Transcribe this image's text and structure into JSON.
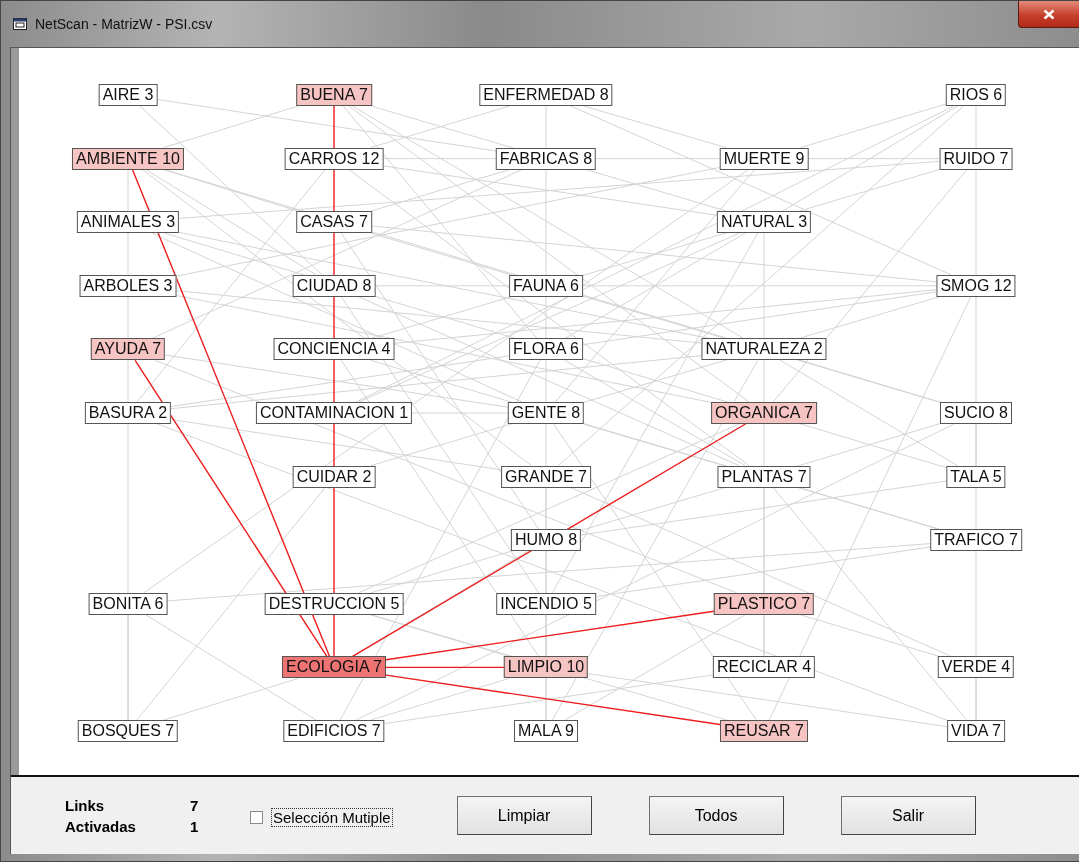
{
  "window": {
    "title": "NetScan - MatrizW - PSI.csv"
  },
  "graph": {
    "rows": [
      {
        "cells": [
          {
            "kind": "node",
            "label": "AIRE 3",
            "linked": false,
            "selected": false
          },
          {
            "kind": "node",
            "label": "BUENA 7",
            "linked": true,
            "selected": false
          },
          {
            "kind": "node",
            "label": "ENFERMEDAD 8",
            "linked": false,
            "selected": false
          },
          {
            "kind": "gap"
          },
          {
            "kind": "node",
            "label": "RIOS 6",
            "linked": false,
            "selected": false
          }
        ]
      },
      {
        "cells": [
          {
            "kind": "node",
            "label": "AMBIENTE 10",
            "linked": true,
            "selected": false
          },
          {
            "kind": "node",
            "label": "CARROS 12",
            "linked": false,
            "selected": false
          },
          {
            "kind": "node",
            "label": "FABRICAS 8",
            "linked": false,
            "selected": false
          },
          {
            "kind": "node",
            "label": "MUERTE 9",
            "linked": false,
            "selected": false
          },
          {
            "kind": "node",
            "label": "RUIDO 7",
            "linked": false,
            "selected": false
          }
        ]
      },
      {
        "cells": [
          {
            "kind": "node",
            "label": "ANIMALES 3",
            "linked": false,
            "selected": false
          },
          {
            "kind": "node",
            "label": "CASAS 7",
            "linked": false,
            "selected": false
          },
          {
            "kind": "gap"
          },
          {
            "kind": "node",
            "label": "NATURAL 3",
            "linked": false,
            "selected": false
          },
          {
            "kind": "gap"
          }
        ]
      },
      {
        "cells": [
          {
            "kind": "node",
            "label": "ARBOLES 3",
            "linked": false,
            "selected": false
          },
          {
            "kind": "node",
            "label": "CIUDAD 8",
            "linked": false,
            "selected": false
          },
          {
            "kind": "node",
            "label": "FAUNA 6",
            "linked": false,
            "selected": false
          },
          {
            "kind": "gap"
          },
          {
            "kind": "node",
            "label": "SMOG 12",
            "linked": false,
            "selected": false
          }
        ]
      },
      {
        "cells": [
          {
            "kind": "node",
            "label": "AYUDA 7",
            "linked": true,
            "selected": false
          },
          {
            "kind": "node",
            "label": "CONCIENCIA 4",
            "linked": false,
            "selected": false
          },
          {
            "kind": "node",
            "label": "FLORA 6",
            "linked": false,
            "selected": false
          },
          {
            "kind": "node",
            "label": "NATURALEZA 2",
            "linked": false,
            "selected": false
          },
          {
            "kind": "gap"
          }
        ]
      },
      {
        "cells": [
          {
            "kind": "node",
            "label": "BASURA 2",
            "linked": false,
            "selected": false
          },
          {
            "kind": "node",
            "label": "CONTAMINACION 1",
            "linked": false,
            "selected": false
          },
          {
            "kind": "node",
            "label": "GENTE 8",
            "linked": false,
            "selected": false
          },
          {
            "kind": "node",
            "label": "ORGANICA 7",
            "linked": true,
            "selected": false
          },
          {
            "kind": "node",
            "label": "SUCIO 8",
            "linked": false,
            "selected": false
          }
        ]
      },
      {
        "cells": [
          {
            "kind": "gap"
          },
          {
            "kind": "node",
            "label": "CUIDAR 2",
            "linked": false,
            "selected": false
          },
          {
            "kind": "node",
            "label": "GRANDE 7",
            "linked": false,
            "selected": false
          },
          {
            "kind": "node",
            "label": "PLANTAS 7",
            "linked": false,
            "selected": false
          },
          {
            "kind": "node",
            "label": "TALA 5",
            "linked": false,
            "selected": false
          }
        ]
      },
      {
        "cells": [
          {
            "kind": "gap"
          },
          {
            "kind": "gap"
          },
          {
            "kind": "node",
            "label": "HUMO 8",
            "linked": false,
            "selected": false
          },
          {
            "kind": "gap"
          },
          {
            "kind": "node",
            "label": "TRAFICO 7",
            "linked": false,
            "selected": false
          }
        ]
      },
      {
        "cells": [
          {
            "kind": "node",
            "label": "BONITA 6",
            "linked": false,
            "selected": false
          },
          {
            "kind": "node",
            "label": "DESTRUCCION 5",
            "linked": false,
            "selected": false
          },
          {
            "kind": "node",
            "label": "INCENDIO 5",
            "linked": false,
            "selected": false
          },
          {
            "kind": "node",
            "label": "PLASTICO 7",
            "linked": true,
            "selected": false
          },
          {
            "kind": "gap"
          }
        ]
      },
      {
        "cells": [
          {
            "kind": "gap"
          },
          {
            "kind": "node",
            "label": "ECOLOGIA 7",
            "linked": false,
            "selected": true
          },
          {
            "kind": "node",
            "label": "LIMPIO 10",
            "linked": true,
            "selected": false
          },
          {
            "kind": "node",
            "label": "RECICLAR 4",
            "linked": false,
            "selected": false
          },
          {
            "kind": "node",
            "label": "VERDE 4",
            "linked": false,
            "selected": false
          }
        ]
      },
      {
        "cells": [
          {
            "kind": "node",
            "label": "BOSQUES 7",
            "linked": false,
            "selected": false
          },
          {
            "kind": "node",
            "label": "EDIFICIOS 7",
            "linked": false,
            "selected": false
          },
          {
            "kind": "node",
            "label": "MALA 9",
            "linked": false,
            "selected": false
          },
          {
            "kind": "node",
            "label": "REUSAR 7",
            "linked": true,
            "selected": false
          },
          {
            "kind": "node",
            "label": "VIDA 7",
            "linked": false,
            "selected": false
          }
        ]
      }
    ]
  },
  "stats": [
    {
      "label": "Links",
      "value": "7"
    },
    {
      "label": "Activadas",
      "value": "1"
    }
  ],
  "multiple_selection": {
    "label": "Selección Mutiple",
    "checked": false,
    "focused": true
  },
  "buttons": [
    "Limpiar",
    "Todos",
    "Salir"
  ]
}
